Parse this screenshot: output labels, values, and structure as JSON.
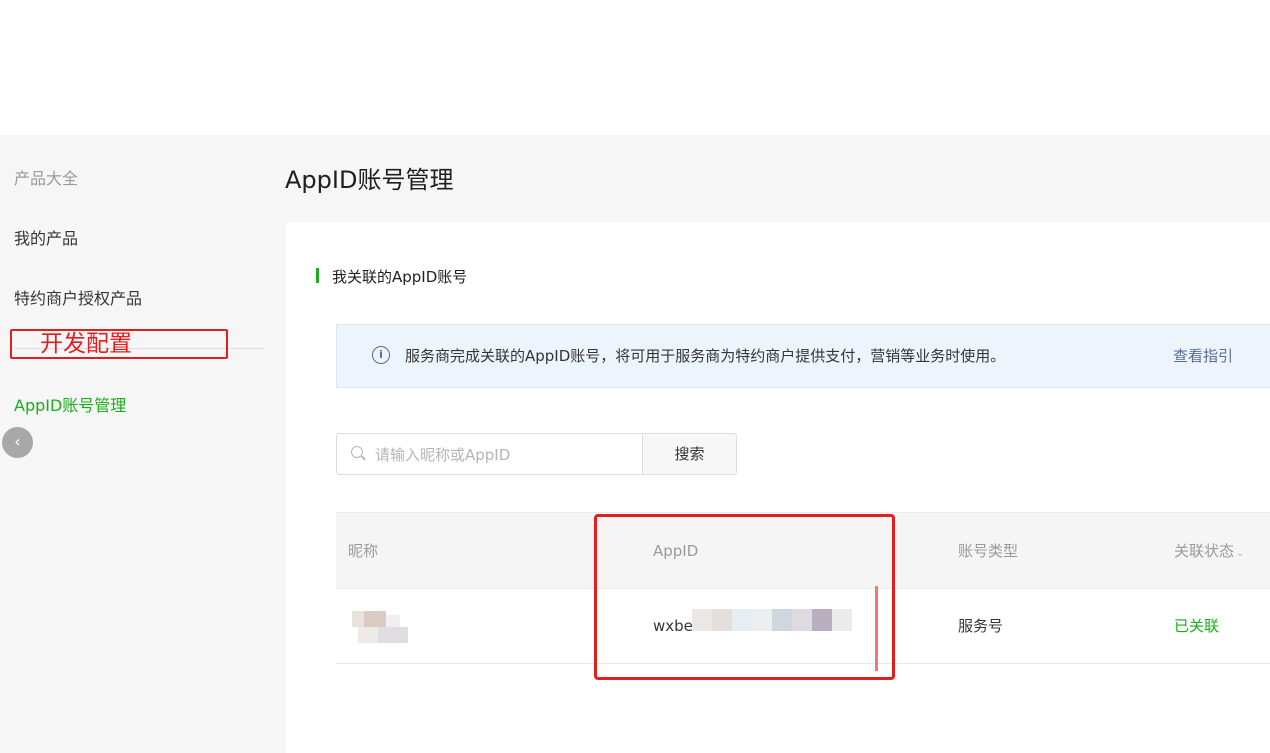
{
  "sidebar": {
    "category": "产品大全",
    "items": [
      {
        "label": "我的产品"
      },
      {
        "label": "特约商户授权产品"
      },
      {
        "label": "开发配置"
      },
      {
        "label": "AppID账号管理"
      }
    ],
    "collapse_icon": "chevron-left-icon"
  },
  "main": {
    "title": "AppID账号管理",
    "section_title": "我关联的AppID账号",
    "notice": {
      "icon": "info-icon",
      "text": "服务商完成关联的AppID账号，将可用于服务商为特约商户提供支付，营销等业务时使用。",
      "link": "查看指引"
    },
    "search": {
      "placeholder": "请输入昵称或AppID",
      "button": "搜索"
    },
    "table": {
      "headers": [
        "昵称",
        "AppID",
        "账号类型",
        "关联状态"
      ],
      "rows": [
        {
          "nickname": "",
          "appid": "wxbe",
          "type": "服务号",
          "status": "已关联"
        }
      ]
    }
  },
  "colors": {
    "accent": "#1aad19",
    "link": "#576b95",
    "annotation": "#e02020"
  }
}
